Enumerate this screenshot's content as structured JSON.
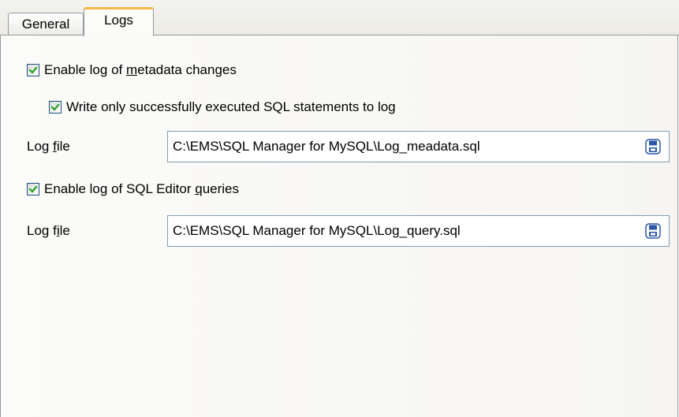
{
  "tabs": [
    {
      "label": "General",
      "active": false
    },
    {
      "label": "Logs",
      "active": true
    }
  ],
  "metadata_log": {
    "enable_label_pre": "Enable log of ",
    "enable_label_acc": "m",
    "enable_label_post": "etadata changes",
    "enable_checked": true,
    "only_success_label": "Write only successfully executed SQL statements to log",
    "only_success_checked": true,
    "file_label_pre": "Log ",
    "file_label_acc": "f",
    "file_label_post": "ile",
    "file_path": "C:\\EMS\\SQL Manager for MySQL\\Log_meadata.sql"
  },
  "query_log": {
    "enable_label_pre": "Enable log of SQL Editor ",
    "enable_label_acc": "q",
    "enable_label_post": "ueries",
    "enable_checked": true,
    "file_label_pre": "Log f",
    "file_label_acc": "i",
    "file_label_post": "le",
    "file_path": "C:\\EMS\\SQL Manager for MySQL\\Log_query.sql"
  },
  "colors": {
    "accent_tab": "#f5b646",
    "check_mark": "#21a121",
    "border": "#919b9c",
    "input_border": "#7f9db9"
  },
  "icons": {
    "checkbox_mark": "check-mark-icon",
    "save_button": "floppy-disk-icon"
  }
}
